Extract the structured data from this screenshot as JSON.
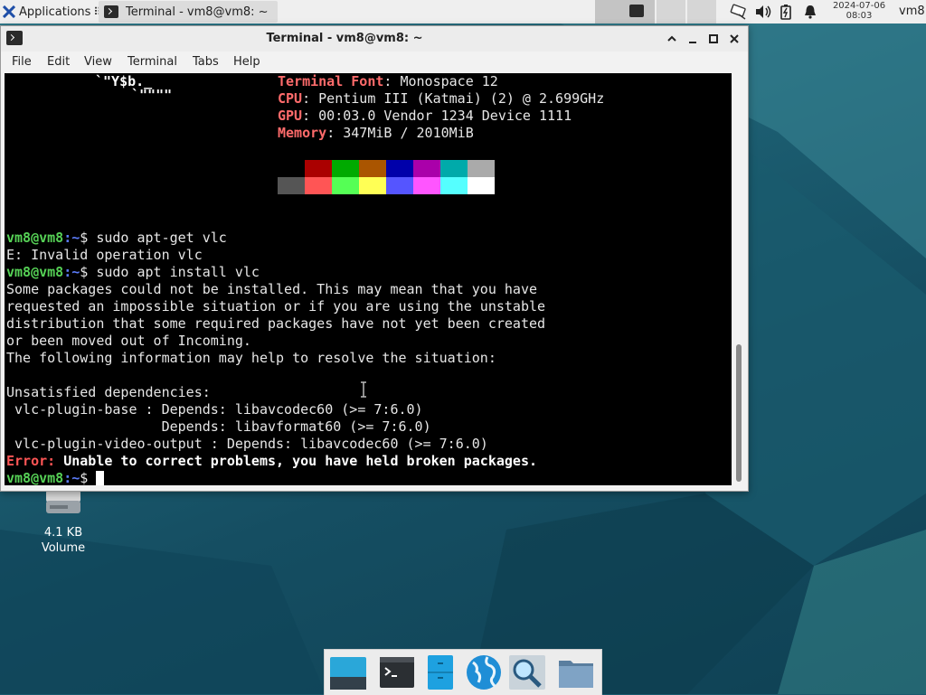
{
  "panel": {
    "applications_label": "Applications",
    "task_title": "Terminal - vm8@vm8: ~",
    "clock_date": "2024-07-06",
    "clock_time": "08:03",
    "user": "vm8"
  },
  "window": {
    "title": "Terminal - vm8@vm8: ~",
    "menu": [
      "File",
      "Edit",
      "View",
      "Terminal",
      "Tabs",
      "Help"
    ]
  },
  "desktop_icon": {
    "size": "4.1 KB",
    "label": "Volume"
  },
  "terminal": {
    "logo_line1": "`\"Y$b._",
    "logo_line2": "`\"\"\"\"",
    "info": [
      {
        "key": "Terminal Font",
        "value": ": Monospace 12"
      },
      {
        "key": "CPU",
        "value": ": Pentium III (Katmai) (2) @ 2.699GHz"
      },
      {
        "key": "GPU",
        "value": ": 00:03.0 Vendor 1234 Device 1111"
      },
      {
        "key": "Memory",
        "value": ": 347MiB / 2010MiB"
      }
    ],
    "palette_top": [
      "#000000",
      "#aa0000",
      "#00aa00",
      "#aa5500",
      "#0000aa",
      "#aa00aa",
      "#00aaaa",
      "#aaaaaa"
    ],
    "palette_bottom": [
      "#555555",
      "#ff5555",
      "#55ff55",
      "#ffff55",
      "#5555ff",
      "#ff55ff",
      "#55ffff",
      "#ffffff"
    ],
    "prompt_user": "vm8@vm8",
    "prompt_path": ":~",
    "prompt_symbol": "$ ",
    "cmd1": "sudo apt-get vlc",
    "out1": "E: Invalid operation vlc",
    "cmd2": "sudo apt install vlc",
    "out2": [
      "Some packages could not be installed. This may mean that you have",
      "requested an impossible situation or if you are using the unstable",
      "distribution that some required packages have not yet been created",
      "or been moved out of Incoming.",
      "The following information may help to resolve the situation:",
      "",
      "Unsatisfied dependencies:",
      " vlc-plugin-base : Depends: libavcodec60 (>= 7:6.0)",
      "                   Depends: libavformat60 (>= 7:6.0)",
      " vlc-plugin-video-output : Depends: libavcodec60 (>= 7:6.0)"
    ],
    "error_label": "Error:",
    "error_text": " Unable to correct problems, you have held broken packages."
  },
  "dock": {
    "items": [
      "show-desktop",
      "terminal",
      "file-manager",
      "web-browser",
      "app-finder",
      "home-folder"
    ]
  }
}
